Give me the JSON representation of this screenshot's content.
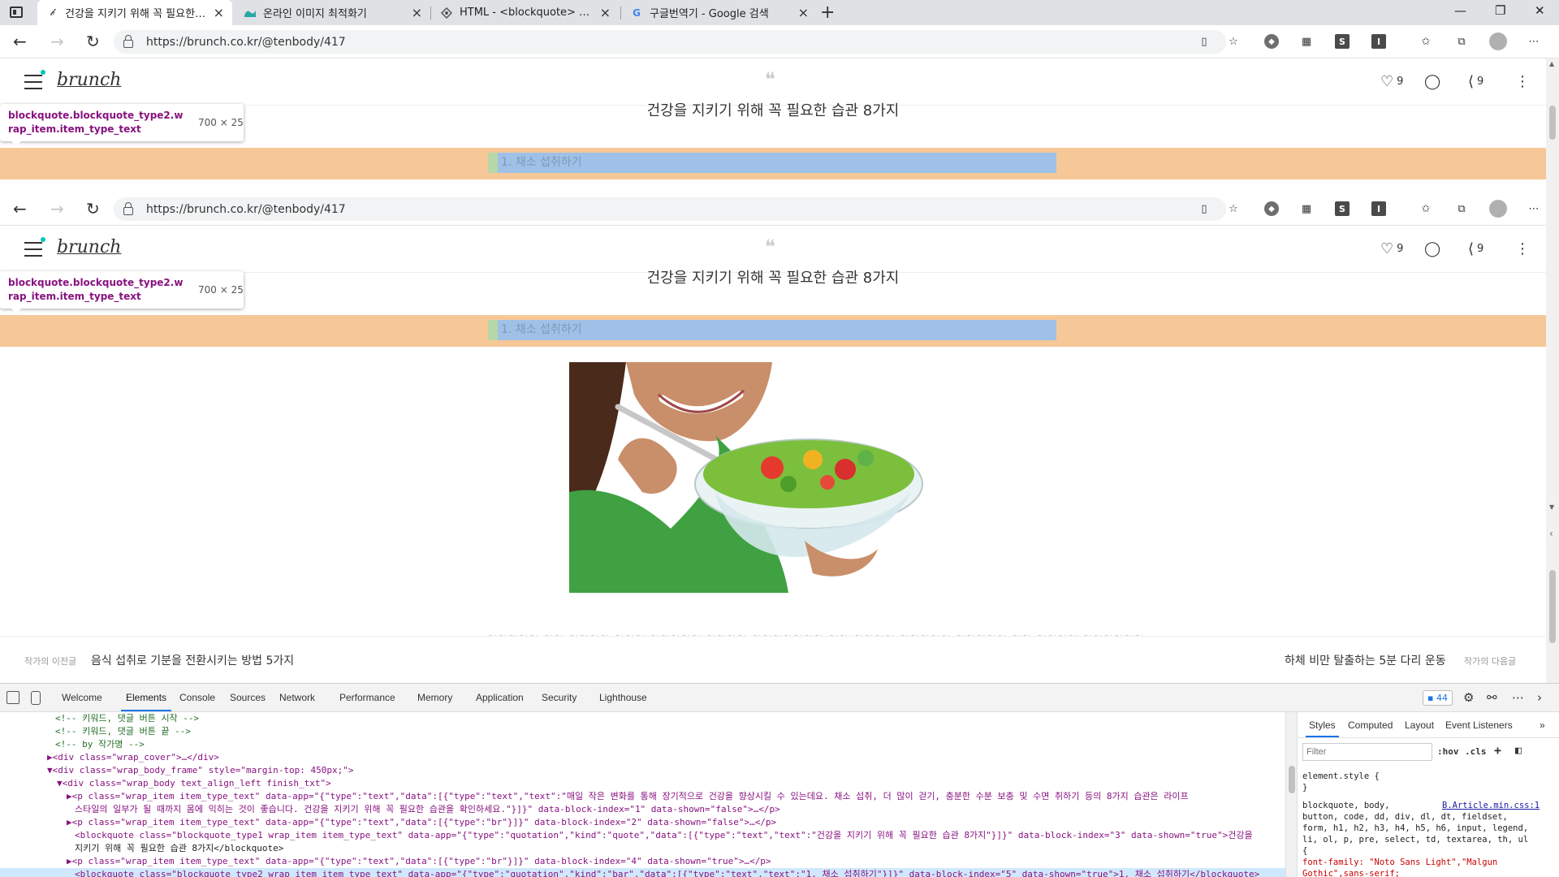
{
  "tabs": [
    {
      "title": "건강을 지키기 위해 꼭 필요한 습관",
      "favicon": "brunch-b-icon",
      "active": true
    },
    {
      "title": "온라인 이미지 최적화기",
      "favicon": "image-optimizer-icon",
      "active": false
    },
    {
      "title": "HTML - <blockquote> Tag - Tutorials",
      "favicon": "tutorialspoint-icon",
      "active": false
    },
    {
      "title": "구글번역기 - Google 검색",
      "favicon": "google-g-icon",
      "active": false
    }
  ],
  "address": {
    "url": "https://brunch.co.kr/@tenbody/417"
  },
  "header": {
    "brand": "brunch",
    "quote_mark": "❝",
    "like_count": "9",
    "share_count": "9"
  },
  "article": {
    "title_peek": "건강을 지키기 위해 꼭 필요한 습관 8가지",
    "blockquote_text": "1. 채소 섭취하기",
    "body_peek": "~~~~~ ~~ ~~~~ ~~~ ~~~~~ ~~~~ ~~~~~~~ ~~ ~~~~ ~~~~~ ~~~~~ ~~ ~~~~ ~~~~~~"
  },
  "inspector": {
    "selector": "blockquote.blockquote_type2.wrap_item.item_type_text",
    "size": "700 × 25"
  },
  "footer_nav": {
    "prev_label": "작가의 이전글",
    "prev_title": "음식 섭취로 기분을 전환시키는 방법 5가지",
    "next_title": "하체 비만 탈출하는 5분 다리 운동",
    "next_label": "작가의 다음글"
  },
  "devtools": {
    "tabs": [
      "Welcome",
      "Elements",
      "Console",
      "Sources",
      "Network",
      "Performance",
      "Memory",
      "Application",
      "Security",
      "Lighthouse"
    ],
    "active_tab": "Elements",
    "issues_count": "44",
    "dom_lines": [
      "<!-- 키워드, 댓글 버튼 시작 -->",
      "<!-- 키워드, 댓글 버튼 끝 -->",
      "<!-- by 작가명 -->",
      "▶<div class=\"wrap_cover\">…</div>",
      "▼<div class=\"wrap_body_frame\" style=\"margin-top: 450px;\">",
      "▼<div class=\"wrap_body text_align_left finish_txt\">",
      "▶<p class=\"wrap_item item_type_text\" data-app=\"{\"type\":\"text\",\"data\":[{\"type\":\"text\",\"text\":\"매일 작은 변화를 통해 장기적으로 건강을 향상시킬 수 있는데요. 채소 섭취, 더 많이 걷기, 충분한 수분 보충 및 수면 취하기 등의 8가지 습관은 라이프",
      "스타일의 일부가 될 때까지 몸에 익히는 것이 좋습니다. 건강을 지키기 위해 꼭 필요한 습관을 확인하세요.\"}]}\" data-block-index=\"1\" data-shown=\"false\">…</p>",
      "▶<p class=\"wrap_item item_type_text\" data-app=\"{\"type\":\"text\",\"data\":[{\"type\":\"br\"}]}\" data-block-index=\"2\" data-shown=\"false\">…</p>",
      "<blockquote class=\"blockquote_type1 wrap_item item_type_text\" data-app=\"{\"type\":\"quotation\",\"kind\":\"quote\",\"data\":[{\"type\":\"text\",\"text\":\"건강을 지키기 위해 꼭 필요한 습관 8가지\"}]}\" data-block-index=\"3\" data-shown=\"true\">건강을",
      "지키기 위해 꼭 필요한 습관 8가지</blockquote>",
      "▶<p class=\"wrap_item item_type_text\" data-app=\"{\"type\":\"text\",\"data\":[{\"type\":\"br\"}]}\" data-block-index=\"4\" data-shown=\"true\">…</p>",
      "<blockquote class=\"blockquote_type2 wrap_item item_type_text\" data-app=\"{\"type\":\"quotation\",\"kind\":\"bar\",\"data\":[{\"type\":\"text\",\"text\":\"1. 채소 섭취하기\"}]}\" data-block-index=\"5\" data-shown=\"true\">1. 채소 섭취하기</blockquote>"
    ],
    "styles_tabs": [
      "Styles",
      "Computed",
      "Layout",
      "Event Listeners"
    ],
    "filter_placeholder": "Filter",
    "hov": ":hov",
    "cls": ".cls",
    "css_lines": [
      "element.style {",
      "}",
      "blockquote, body,",
      "button, code, dd, div, dl, dt, fieldset,",
      "form, h1, h2, h3, h4, h5, h6, input, legend,",
      "li, ol, p, pre, select, td, textarea, th, ul",
      "{",
      "  font-family: \"Noto Sans Light\",\"Malgun",
      "    Gothic\",sans-serif;"
    ],
    "css_source": "B.Article.min.css:1"
  }
}
